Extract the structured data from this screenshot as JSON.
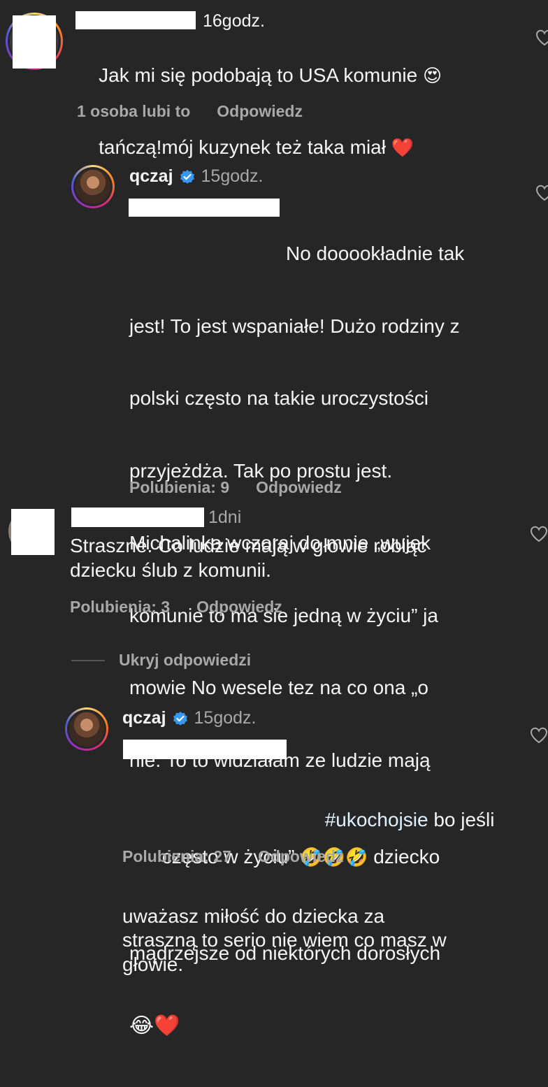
{
  "comments": [
    {
      "time": "16godz.",
      "text_a": "Jak mi się podobają to USA komunie ",
      "emoji_a": "😍",
      "text_b": "tańczą!mój kuzynek też taka miał ",
      "emoji_b": "❤️",
      "likes": "1 osoba lubi to",
      "reply": "Odpowiedz"
    },
    {
      "username": "qczaj",
      "time": "15godz.",
      "lines": [
        "No dooookładnie tak",
        "jest! To jest wspaniałe! Dużo rodziny z",
        "polski często na takie uroczystości",
        "przyjeżdża. Tak po prostu jest.",
        "Michalinka wczoraj do mnie „wujek",
        "komunie to ma sie jedną w życiu” ja",
        "mowie No wesele tez na co ona „o",
        "nie. To to widziałam ze ludzie mają"
      ],
      "line9_a": "często w życiu” ",
      "line9_emoji": "🤣🤣🤣",
      "line9_b": " dziecko",
      "line10": "mądrzejsze od niektórych dorosłych",
      "end_emoji": "😂❤️",
      "likes": "Polubienia: 9",
      "reply": "Odpowiedz"
    },
    {
      "time": "1dni",
      "text": "Straszne. Co ludzie mają w głowie robiąc\ndziecku ślub z komunii.",
      "likes": "Polubienia: 3",
      "reply": "Odpowiedz"
    },
    {
      "username": "qczaj",
      "time": "15godz.",
      "hashtag": "#ukochojsie",
      "line1_rest": " bo jeśli",
      "text": "uważasz miłość do dziecka za\nstraszną to serio nie wiem co masz w\ngłowie.",
      "likes": "Polubienia: 27",
      "reply": "Odpowiedz"
    }
  ],
  "hide_replies": "Ukryj odpowiedzi",
  "colors": {
    "background": "#262626",
    "text": "#f5f5f5",
    "muted": "#a8a8a8",
    "verified": "#3897f0"
  },
  "icons": [
    "heart-icon",
    "verified-badge-icon"
  ]
}
